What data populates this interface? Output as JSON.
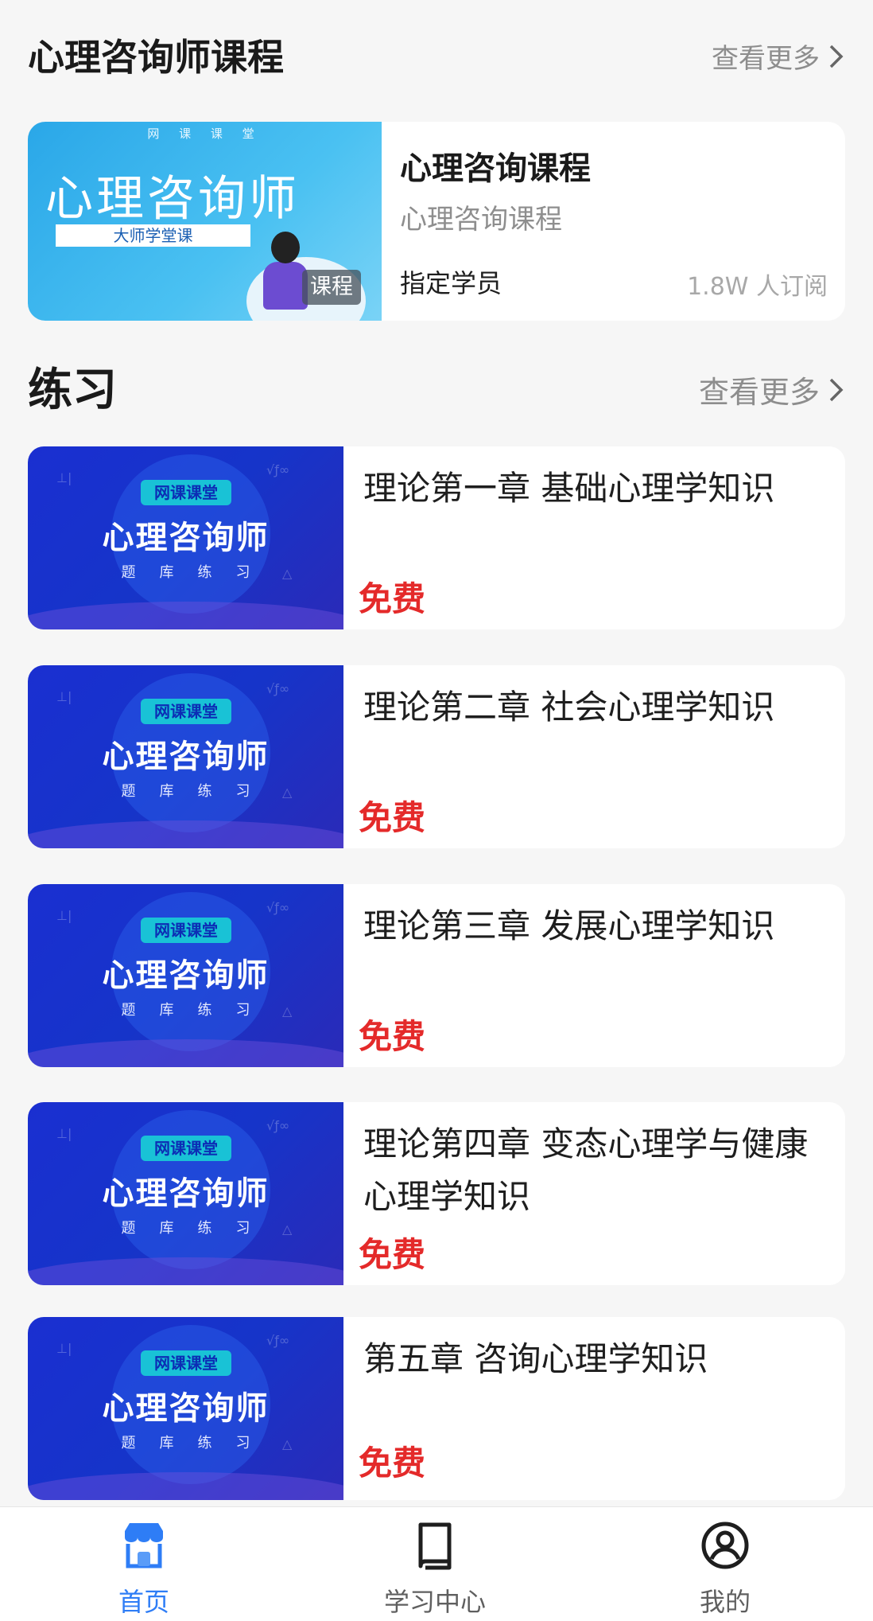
{
  "sections": {
    "course": {
      "title": "心理咨询师课程",
      "more": "查看更多"
    },
    "practice": {
      "title": "练习",
      "more": "查看更多"
    }
  },
  "course_card": {
    "thumb_tag": "网 课 课 堂",
    "thumb_title": "心理咨询师",
    "thumb_ribbon": "大师学堂课",
    "badge": "课程",
    "title": "心理咨询课程",
    "subtitle": "心理咨询课程",
    "audience": "指定学员",
    "subscribers": "1.8W 人订阅"
  },
  "practice_thumb": {
    "pill": "网课课堂",
    "title": "心理咨询师",
    "caption": "题库练习"
  },
  "practice_items": [
    {
      "title": "理论第一章 基础心理学知识",
      "price": "免费"
    },
    {
      "title": "理论第二章 社会心理学知识",
      "price": "免费"
    },
    {
      "title": "理论第三章 发展心理学知识",
      "price": "免费"
    },
    {
      "title": "理论第四章 变态心理学与健康心理学知识",
      "price": "免费"
    },
    {
      "title": "第五章 咨询心理学知识",
      "price": "免费"
    }
  ],
  "tabbar": {
    "items": [
      {
        "label": "首页",
        "icon": "store-icon",
        "active": true
      },
      {
        "label": "学习中心",
        "icon": "book-icon",
        "active": false
      },
      {
        "label": "我的",
        "icon": "user-icon",
        "active": false
      }
    ]
  },
  "colors": {
    "accent": "#2e7df6",
    "price": "#e42a2a"
  }
}
